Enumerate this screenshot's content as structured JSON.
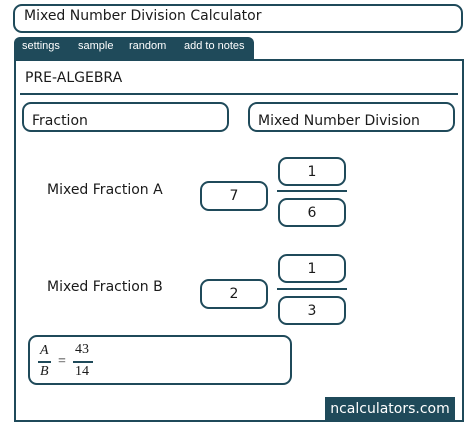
{
  "header": {
    "title": "Mixed Number Division Calculator"
  },
  "tabs": [
    {
      "label": "settings"
    },
    {
      "label": "sample"
    },
    {
      "label": "random"
    },
    {
      "label": "add to notes"
    }
  ],
  "category": "PRE-ALGEBRA",
  "nav": {
    "left": "Fraction",
    "right": "Mixed Number Division"
  },
  "inputs": {
    "a": {
      "label": "Mixed Fraction A",
      "whole": "7",
      "numerator": "1",
      "denominator": "6"
    },
    "b": {
      "label": "Mixed Fraction B",
      "whole": "2",
      "numerator": "1",
      "denominator": "3"
    }
  },
  "result": {
    "lhs_num": "A",
    "lhs_den": "B",
    "equals": "=",
    "num": "43",
    "den": "14"
  },
  "brand": "ncalculators.com",
  "colors": {
    "accent": "#1f4a5a"
  }
}
